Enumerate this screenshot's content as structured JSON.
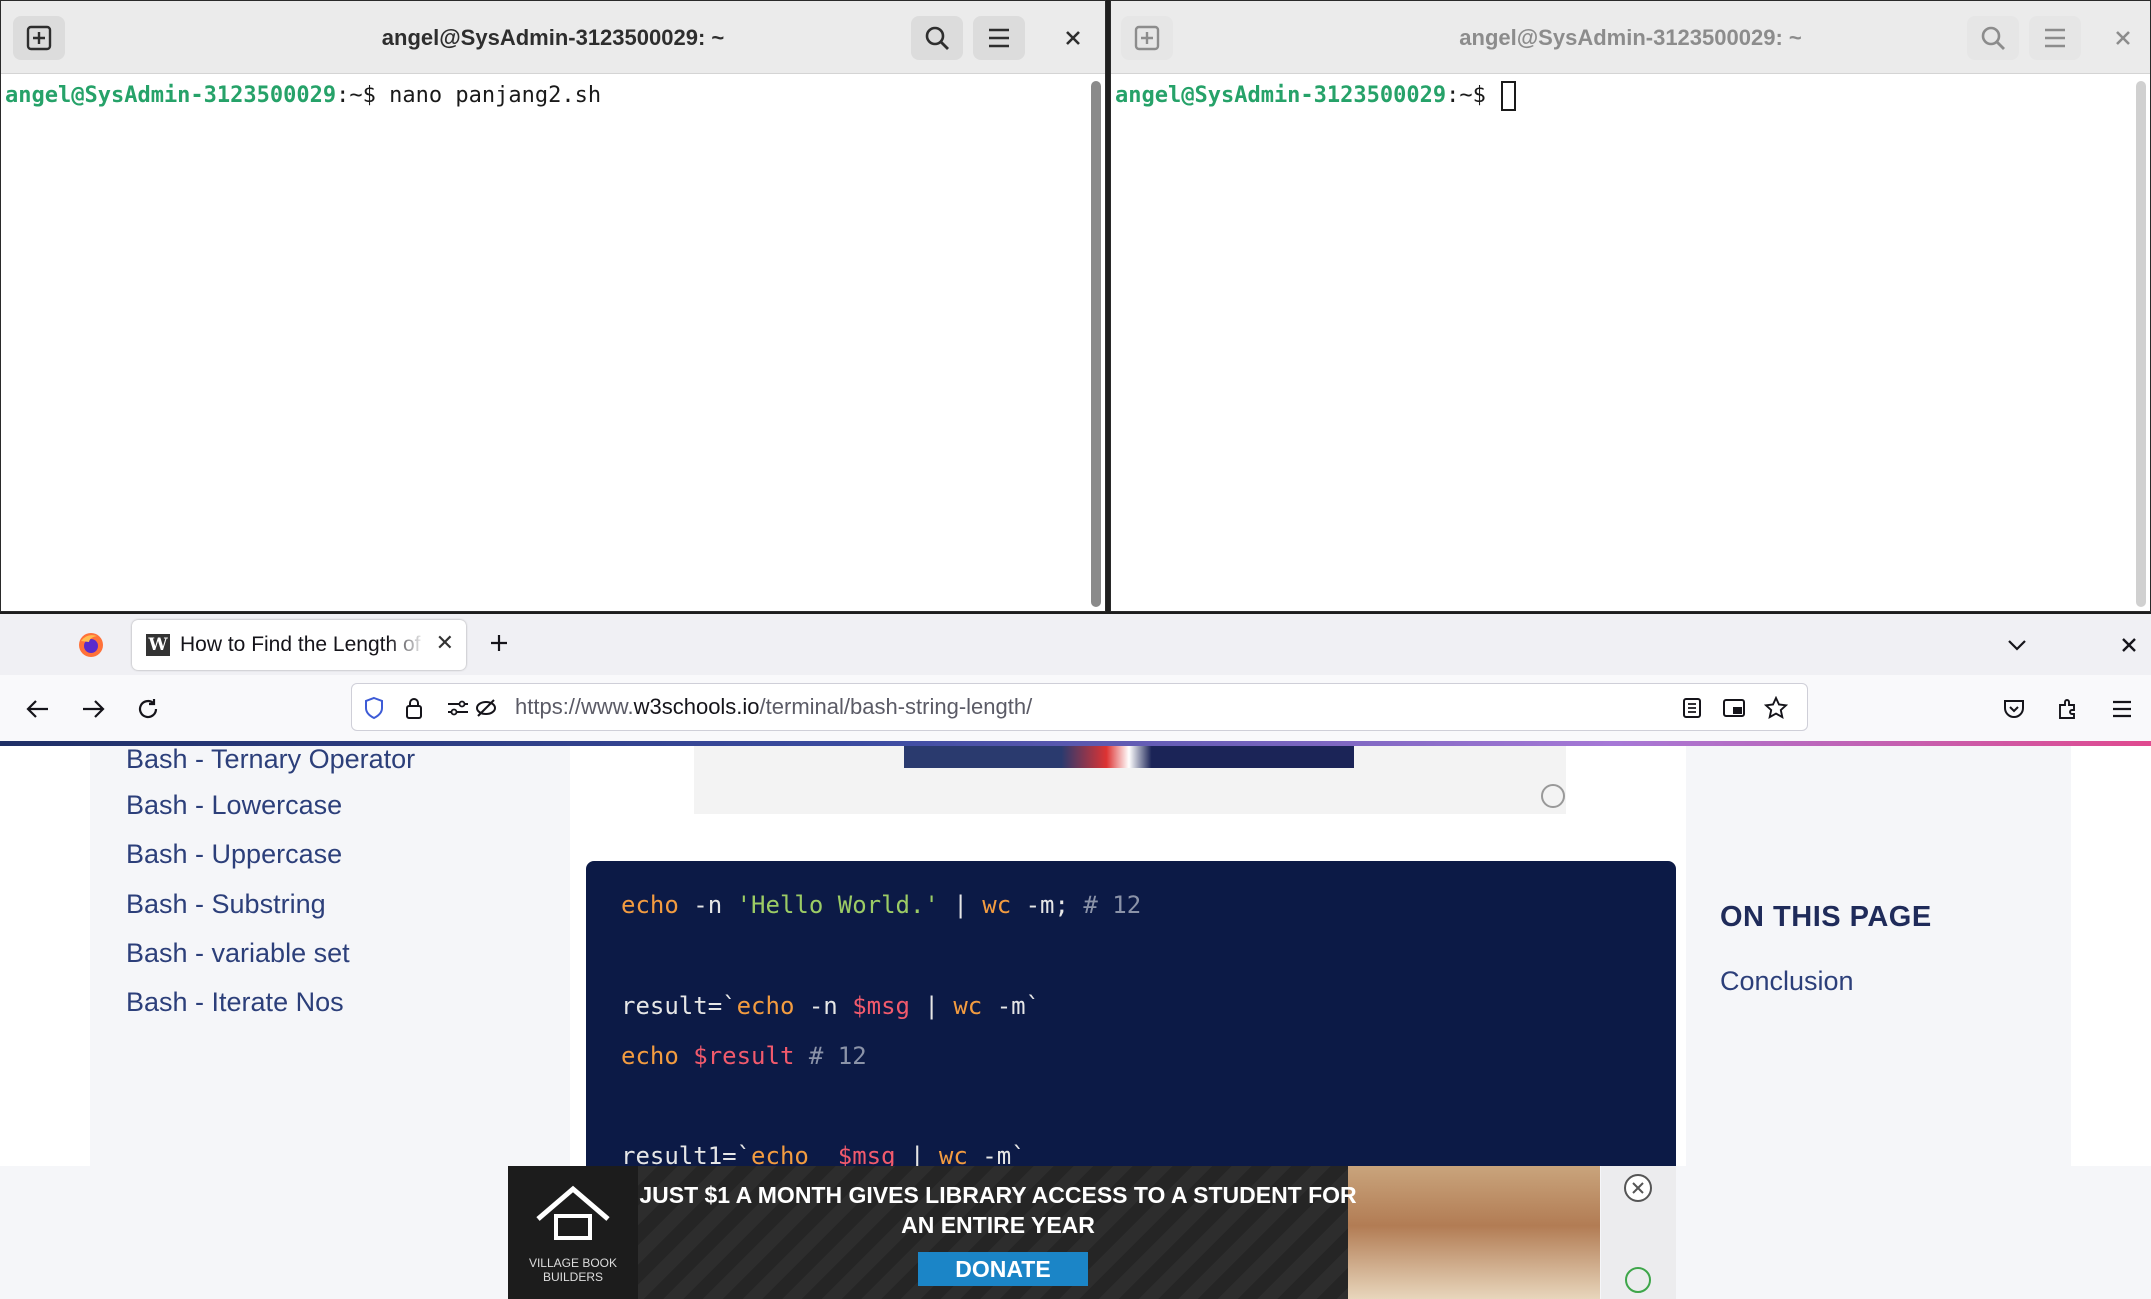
{
  "terminal_left": {
    "title": "angel@SysAdmin-3123500029: ~",
    "prompt_user": "angel@SysAdmin-3123500029",
    "prompt_path": ":~$",
    "command": " nano panjang2.sh"
  },
  "terminal_right": {
    "title": "angel@SysAdmin-3123500029: ~",
    "prompt_user": "angel@SysAdmin-3123500029",
    "prompt_path": ":~$"
  },
  "browser": {
    "tab_title": "How to Find the Length of",
    "url_prefix": "https://www.",
    "url_domain": "w3schools.io",
    "url_path": "/terminal/bash-string-length/"
  },
  "sidebar": {
    "items": [
      {
        "label": "Bash - Ternary Operator"
      },
      {
        "label": "Bash - Lowercase"
      },
      {
        "label": "Bash - Uppercase"
      },
      {
        "label": "Bash - Substring"
      },
      {
        "label": "Bash - variable set"
      },
      {
        "label": "Bash - Iterate Nos"
      }
    ]
  },
  "code": {
    "line1": {
      "a": "echo",
      "b": " -n ",
      "c": "'Hello World.'",
      "d": " | ",
      "e": "wc",
      "f": " -m; ",
      "g": "# 12"
    },
    "line2": {
      "a": "result=`",
      "b": "echo",
      "c": " -n ",
      "d": "$msg",
      "e": " | ",
      "f": "wc",
      "g": " -m`"
    },
    "line3": {
      "a": "echo",
      "b": " ",
      "c": "$result",
      "d": " # 12"
    },
    "line4": {
      "a": "result1=`",
      "b": "echo",
      "c": "  ",
      "d": "$msg",
      "e": " | ",
      "f": "wc",
      "g": " -m`"
    }
  },
  "on_this_page": {
    "title": "ON THIS PAGE",
    "links": [
      "Conclusion"
    ]
  },
  "ad": {
    "headline_1": "JUST $1 A MONTH GIVES LIBRARY ACCESS TO A STUDENT FOR",
    "headline_2": "AN ENTIRE YEAR",
    "donate": "DONATE",
    "brand": "VILLAGE BOOK BUILDERS"
  }
}
